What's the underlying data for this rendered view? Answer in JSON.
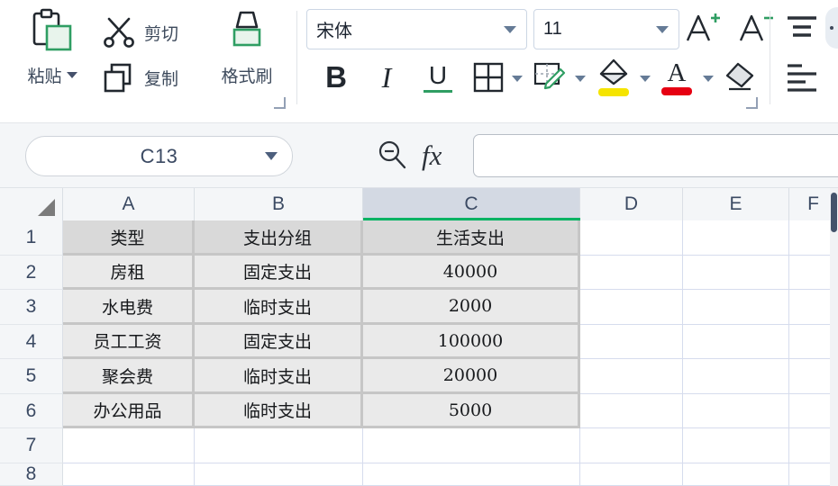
{
  "app": {
    "type": "spreadsheet-editor",
    "accent_green": "#00b263",
    "selected_header_fill": "#d3d9e3"
  },
  "ribbon": {
    "clipboard": {
      "paste_label": "粘贴",
      "paste_icon": "clipboard-icon",
      "paste_caret_icon": "caret-down-icon",
      "cut_label": "剪切",
      "cut_icon": "scissors-icon",
      "copy_label": "复制",
      "copy_icon": "copy-icon",
      "format_painter_label": "格式刷",
      "format_painter_icon": "paint-brush-icon",
      "launcher_icon": "dialog-launcher-icon"
    },
    "font": {
      "family_value": "宋体",
      "size_value": "11",
      "family_caret_icon": "caret-down-icon",
      "size_caret_icon": "caret-down-icon",
      "bold_label": "B",
      "italic_label": "I",
      "underline_label": "U",
      "borders_icon": "borders-icon",
      "cell_style_icon": "cell-style-pencil-icon",
      "fill_color_icon": "fill-bucket-icon",
      "font_color_label": "A",
      "font_color_icon": "font-color-icon",
      "clear_format_icon": "eraser-icon",
      "grow_font_label": "A",
      "grow_font_icon": "increase-font-size-icon",
      "shrink_font_label": "A",
      "shrink_font_icon": "decrease-font-size-icon",
      "launcher_icon": "dialog-launcher-icon"
    },
    "alignment": {
      "align_top_icon": "align-top-icon",
      "align_justify_icon": "align-justify-icon"
    }
  },
  "formula_bar": {
    "name_box_value": "C13",
    "name_box_caret_icon": "caret-down-icon",
    "search_icon": "search-minus-icon",
    "function_icon": "fx-icon",
    "function_label": "fx",
    "formula_value": "",
    "formula_placeholder": ""
  },
  "grid": {
    "select_all_icon": "select-all-corner-icon",
    "columns": [
      "A",
      "B",
      "C",
      "D",
      "E",
      "F"
    ],
    "selected_column": "C",
    "rows": [
      "1",
      "2",
      "3",
      "4",
      "5",
      "6",
      "7",
      "8"
    ],
    "table": {
      "headers": [
        "类型",
        "支出分组",
        "生活支出"
      ],
      "data": [
        [
          "房租",
          "固定支出",
          "40000"
        ],
        [
          "水电费",
          "临时支出",
          "2000"
        ],
        [
          "员工工资",
          "固定支出",
          "100000"
        ],
        [
          "聚会费",
          "临时支出",
          "20000"
        ],
        [
          "办公用品",
          "临时支出",
          "5000"
        ]
      ]
    }
  },
  "scrollbar": {
    "vertical_thumb": "vertical-scroll-thumb"
  }
}
